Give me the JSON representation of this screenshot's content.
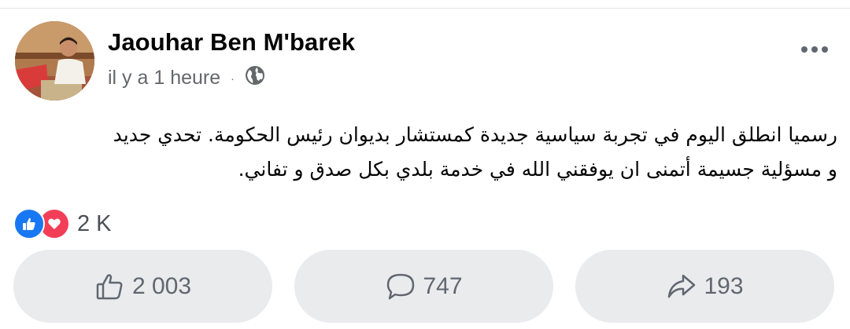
{
  "post": {
    "author": "Jaouhar Ben M'barek",
    "time": "il y a 1 heure",
    "separator": "·",
    "privacy_icon": "globe-icon",
    "more_icon": "more-dots-icon",
    "text_lines": [
      "رسميا انطلق اليوم في تجربة سياسية جديدة كمستشار بديوان رئيس الحكومة. تحدي جديد",
      "و مسؤلية جسيمة أتمنى ان يوفقني الله في خدمة بلدي بكل صدق و تفاني."
    ]
  },
  "reactions": {
    "icons": [
      "like-reaction-icon",
      "love-reaction-icon"
    ],
    "count": "2 K"
  },
  "actions": {
    "like": {
      "icon": "thumbs-up-icon",
      "count": "2 003"
    },
    "comment": {
      "icon": "comment-icon",
      "count": "747"
    },
    "share": {
      "icon": "share-arrow-icon",
      "count": "193"
    }
  },
  "colors": {
    "secondary_text": "#65676b",
    "like_blue": "#1877f2",
    "love_red": "#f33e58",
    "button_bg": "#eaebed"
  }
}
